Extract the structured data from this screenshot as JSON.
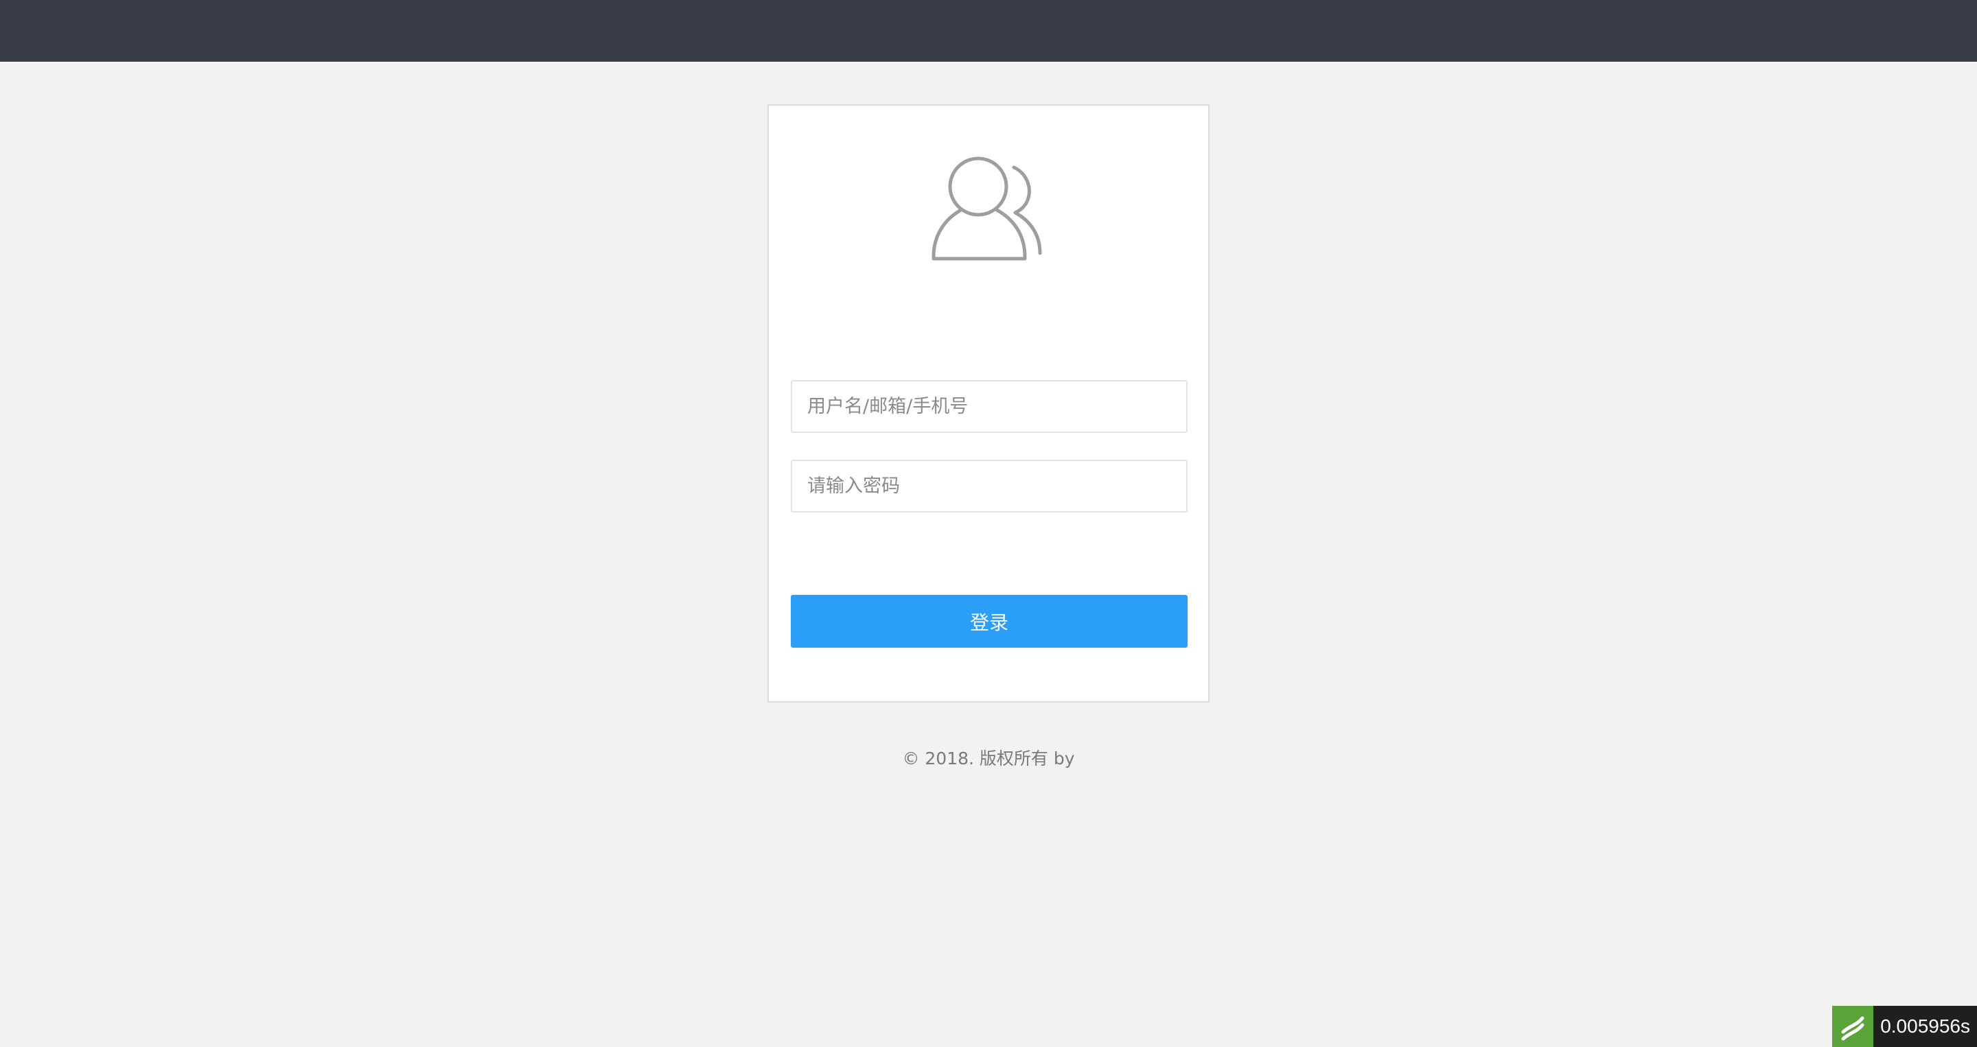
{
  "login": {
    "username_placeholder": "用户名/邮箱/手机号",
    "password_placeholder": "请输入密码",
    "submit_label": "登录"
  },
  "footer": {
    "copyright": "© 2018. 版权所有 by"
  },
  "debug_badge": {
    "time": "0.005956s"
  },
  "colors": {
    "topbar": "#393d49",
    "background": "#f2f2f2",
    "primary": "#2b9ff8",
    "icon_stroke": "#9e9e9e"
  },
  "icons": {
    "avatar": "users-icon",
    "debug": "trace-logo-icon"
  }
}
